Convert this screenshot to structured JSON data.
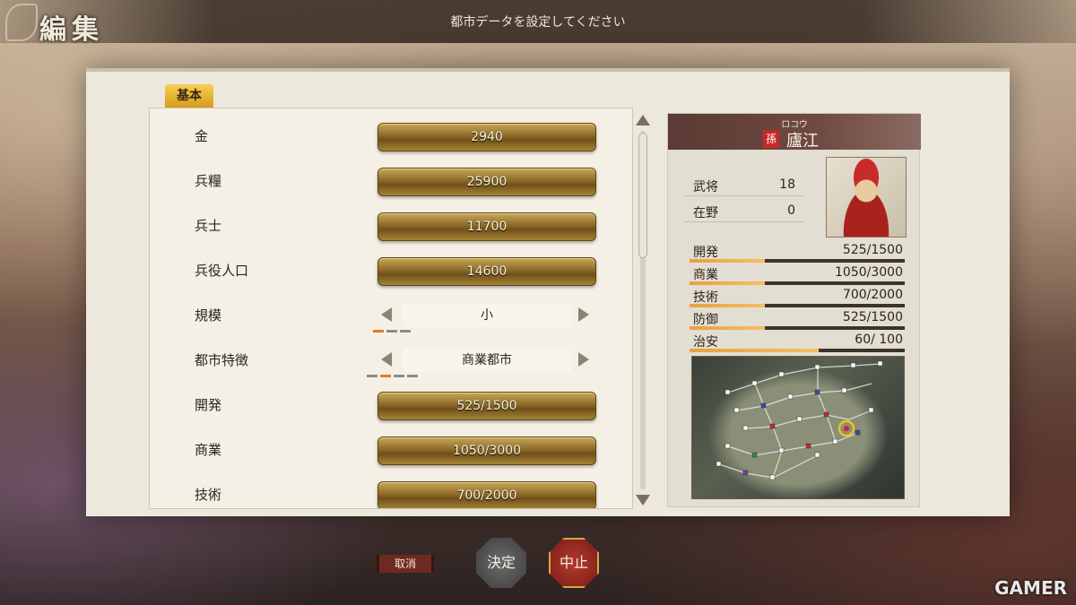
{
  "header": {
    "title": "編集",
    "instruction": "都市データを設定してください"
  },
  "tabs": [
    {
      "label": "基本"
    }
  ],
  "rows": [
    {
      "label": "金",
      "value": "2940"
    },
    {
      "label": "兵糧",
      "value": "25900"
    },
    {
      "label": "兵士",
      "value": "11700"
    },
    {
      "label": "兵役人口",
      "value": "14600"
    },
    {
      "label": "規模",
      "value": "小",
      "options_count": 3,
      "selected_index": 0
    },
    {
      "label": "都市特徴",
      "value": "商業都市",
      "options_count": 4,
      "selected_index": 1
    },
    {
      "label": "開発",
      "value": "525/1500"
    },
    {
      "label": "商業",
      "value": "1050/3000"
    },
    {
      "label": "技術",
      "value": "700/2000"
    }
  ],
  "city": {
    "reading": "ロコウ",
    "name": "廬江",
    "faction": "孫",
    "officers": [
      {
        "label": "武将",
        "value": "18"
      },
      {
        "label": "在野",
        "value": "0"
      }
    ],
    "stats": [
      {
        "label": "開発",
        "value": "525/1500",
        "fill": 0.35
      },
      {
        "label": "商業",
        "value": "1050/3000",
        "fill": 0.35
      },
      {
        "label": "技術",
        "value": "700/2000",
        "fill": 0.35
      },
      {
        "label": "防御",
        "value": "525/1500",
        "fill": 0.35
      },
      {
        "label": "治安",
        "value": "60/ 100",
        "fill": 0.6
      }
    ]
  },
  "actions": {
    "cancel": "取消",
    "confirm": "決定",
    "abort": "中止"
  },
  "watermark": "GAMER",
  "colors": {
    "gold": "#c9a85a",
    "accent": "#e07a20",
    "faction": "#c8282a",
    "stop": "#b23a2e"
  }
}
